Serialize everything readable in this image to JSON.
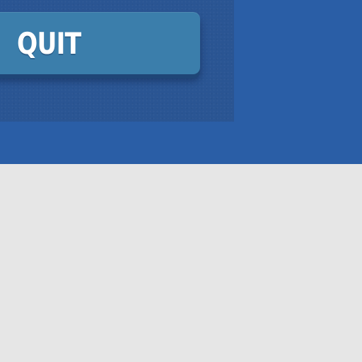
{
  "menu": {
    "quit_label": "QUIT"
  },
  "colors": {
    "backdrop": "#2a5ea6",
    "panel": "#2a5593",
    "button": "#3b7eab",
    "button_text": "#ffffff",
    "page": "#e6e6e6"
  }
}
